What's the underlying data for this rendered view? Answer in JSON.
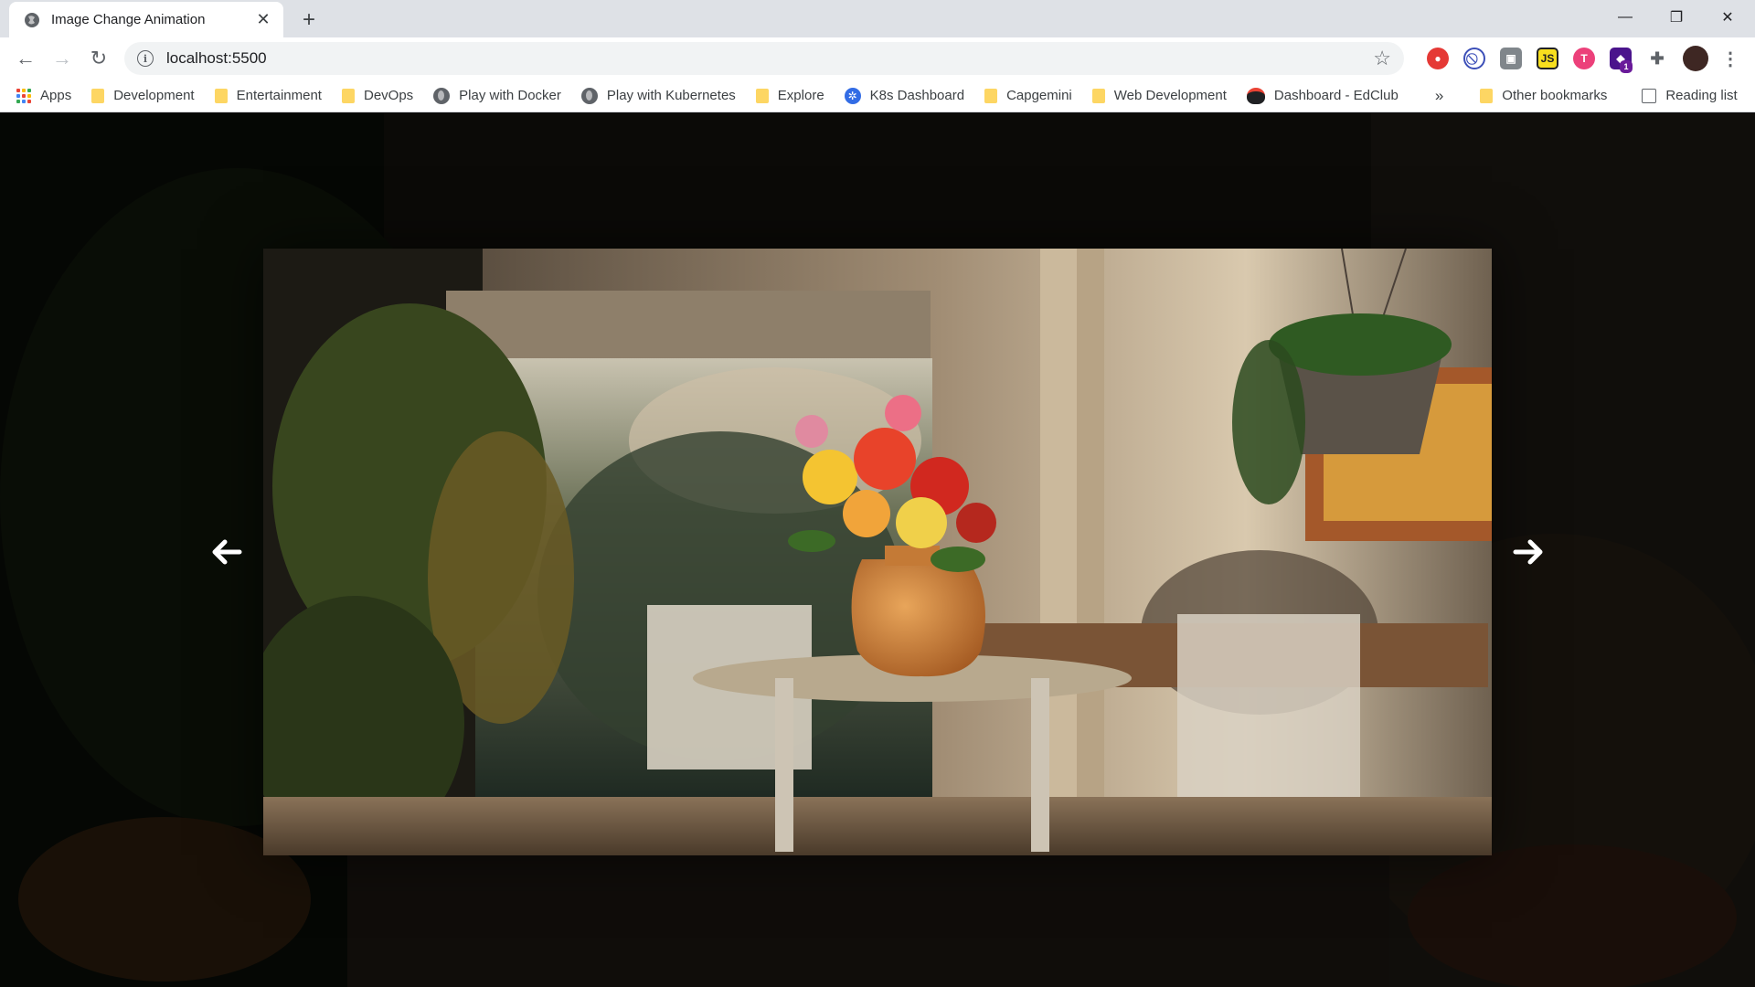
{
  "browser": {
    "tab_title": "Image Change Animation",
    "url": "localhost:5500",
    "ext_badge": "1",
    "bookmarks": [
      {
        "label": "Apps",
        "icon": "apps-grid-icon"
      },
      {
        "label": "Development",
        "icon": "folder-icon"
      },
      {
        "label": "Entertainment",
        "icon": "folder-icon"
      },
      {
        "label": "DevOps",
        "icon": "folder-icon"
      },
      {
        "label": "Play with Docker",
        "icon": "globe-icon"
      },
      {
        "label": "Play with Kubernetes",
        "icon": "globe-icon"
      },
      {
        "label": "Explore",
        "icon": "folder-icon"
      },
      {
        "label": "K8s Dashboard",
        "icon": "kubernetes-icon"
      },
      {
        "label": "Capgemini",
        "icon": "folder-icon"
      },
      {
        "label": "Web Development",
        "icon": "folder-icon"
      },
      {
        "label": "Dashboard - EdClub",
        "icon": "edclub-icon"
      }
    ],
    "overflow_label": "»",
    "other_bookmarks": "Other bookmarks",
    "reading_list": "Reading list"
  },
  "page": {
    "prev_arrow": "left-arrow-icon",
    "next_arrow": "right-arrow-icon",
    "scene": "porch table with flower vase"
  },
  "colors": {
    "accent_red": "#e53935",
    "folder": "#fdd663",
    "k8s_blue": "#326ce5"
  }
}
